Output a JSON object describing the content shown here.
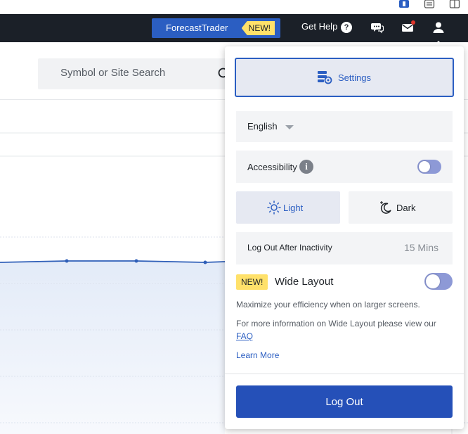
{
  "header": {
    "forecast_trader_label": "ForecastTrader",
    "forecast_trader_badge": "NEW!",
    "get_help_label": "Get Help",
    "help_glyph": "?"
  },
  "search": {
    "placeholder": "Symbol or Site Search"
  },
  "settings_panel": {
    "settings_label": "Settings",
    "language": {
      "selected": "English"
    },
    "accessibility": {
      "label": "Accessibility",
      "info_glyph": "i",
      "enabled": false
    },
    "theme": {
      "light_label": "Light",
      "dark_label": "Dark",
      "selected": "Light"
    },
    "inactivity": {
      "label": "Log Out After Inactivity",
      "value": "15 Mins"
    },
    "wide_layout": {
      "badge": "NEW!",
      "title": "Wide Layout",
      "enabled": false,
      "description": "Maximize your efficiency when on larger screens.",
      "more_info_prefix": "For more information on Wide Layout please view our ",
      "faq_label": "FAQ",
      "learn_more_label": "Learn More"
    },
    "logout_label": "Log Out"
  },
  "colors": {
    "nav_bg": "#1b2028",
    "brand_blue": "#2b5ec2",
    "logout_blue": "#2550b8",
    "badge_yellow": "#ffe16a",
    "toggle_off": "#8d99d6"
  },
  "icons": {
    "strip": [
      "bookmark-icon",
      "extensions-icon",
      "sidebar-icon"
    ],
    "nav": [
      "chat-icon",
      "mail-icon",
      "user-icon"
    ],
    "panel": [
      "settings-icon",
      "info-icon",
      "sun-icon",
      "moon-icon"
    ]
  }
}
